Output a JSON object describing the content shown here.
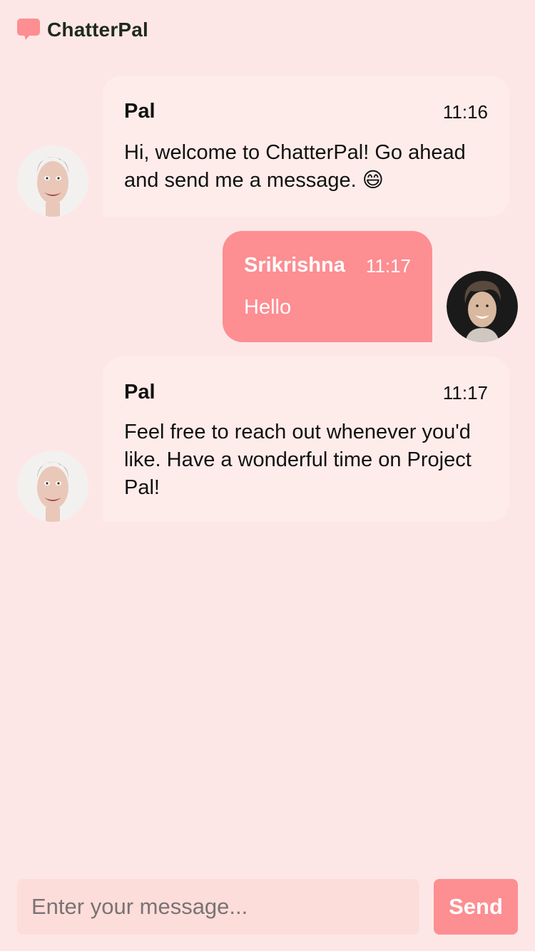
{
  "app": {
    "name": "ChatterPal",
    "logo_icon": "chat-bubble-icon",
    "accent_color": "#fd8e92",
    "background_color": "#fde7e6"
  },
  "messages": [
    {
      "sender": "Pal",
      "time": "11:16",
      "text": "Hi, welcome to ChatterPal! Go ahead and send me a message. 😄",
      "direction": "incoming"
    },
    {
      "sender": "Srikrishna",
      "time": "11:17",
      "text": "Hello",
      "direction": "outgoing"
    },
    {
      "sender": "Pal",
      "time": "11:17",
      "text": "Feel free to reach out whenever you'd like. Have a wonderful time on Project Pal!",
      "direction": "incoming"
    }
  ],
  "composer": {
    "placeholder": "Enter your message...",
    "send_label": "Send"
  }
}
